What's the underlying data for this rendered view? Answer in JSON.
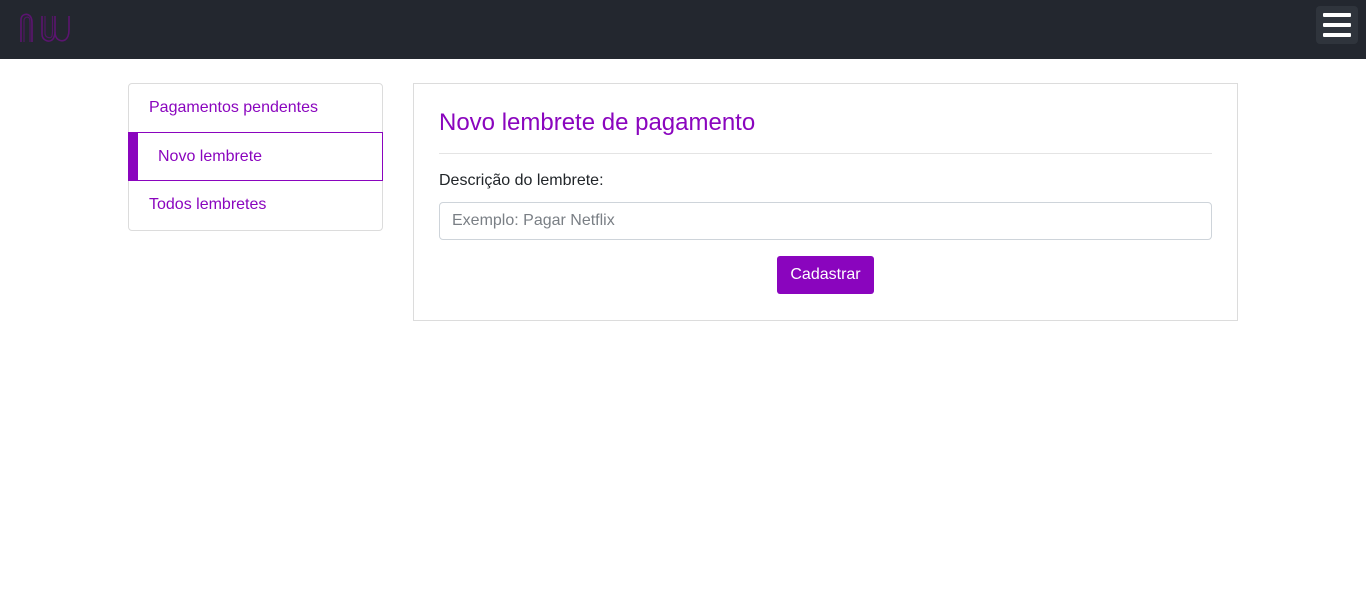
{
  "colors": {
    "navbar_bg": "#23272f",
    "accent": "#8a05be",
    "border": "#dcdcdc"
  },
  "navbar": {
    "logo_icon": "nubank-logo",
    "menu_icon": "hamburger-menu-icon"
  },
  "sidebar": {
    "active_index": 1,
    "items": [
      {
        "label": "Pagamentos pendentes"
      },
      {
        "label": "Novo lembrete"
      },
      {
        "label": "Todos lembretes"
      }
    ]
  },
  "form": {
    "title": "Novo lembrete de pagamento",
    "description_label": "Descrição do lembrete:",
    "description_placeholder": "Exemplo: Pagar Netflix",
    "description_value": "",
    "submit_label": "Cadastrar"
  }
}
